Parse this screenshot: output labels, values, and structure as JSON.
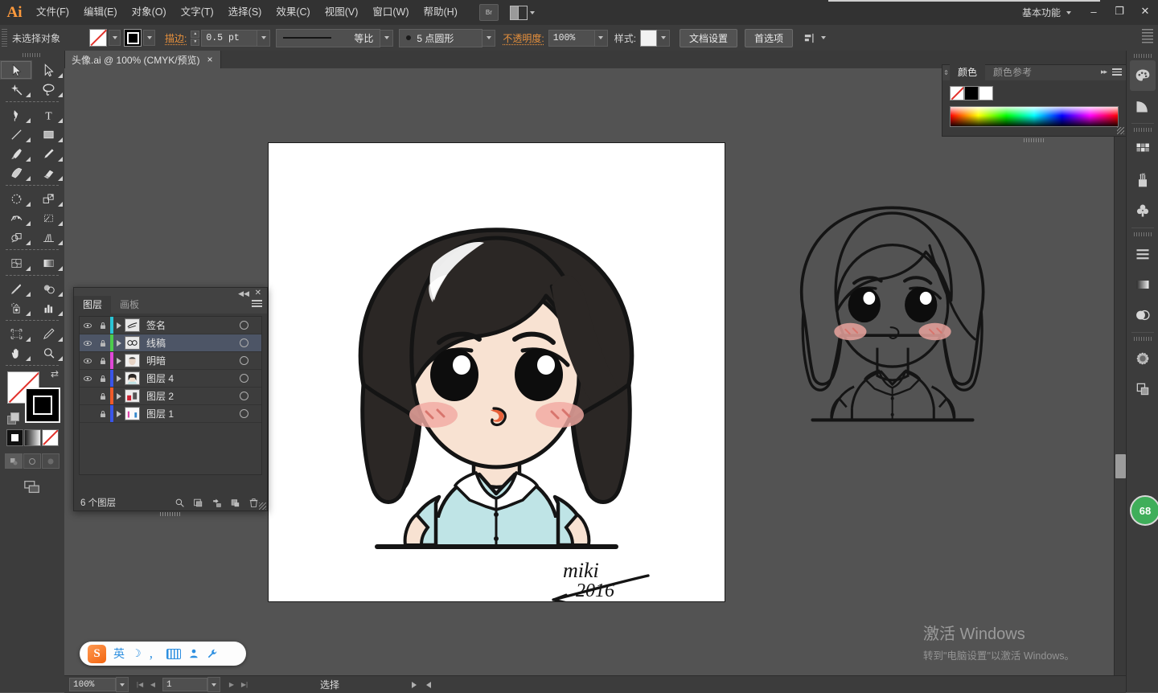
{
  "app": {
    "name": "Adobe Illustrator",
    "logo": "Ai",
    "workspace": "基本功能",
    "minimize": "–",
    "restore": "❐",
    "close": "✕",
    "bridge_label": "Br"
  },
  "menu": {
    "items": [
      {
        "label": "文件(F)",
        "name": "menu-file"
      },
      {
        "label": "编辑(E)",
        "name": "menu-edit"
      },
      {
        "label": "对象(O)",
        "name": "menu-object"
      },
      {
        "label": "文字(T)",
        "name": "menu-type"
      },
      {
        "label": "选择(S)",
        "name": "menu-select"
      },
      {
        "label": "效果(C)",
        "name": "menu-effect"
      },
      {
        "label": "视图(V)",
        "name": "menu-view"
      },
      {
        "label": "窗口(W)",
        "name": "menu-window"
      },
      {
        "label": "帮助(H)",
        "name": "menu-help"
      }
    ]
  },
  "control_bar": {
    "selection_status": "未选择对象",
    "fill_swatch": "none",
    "stroke_swatch": "black",
    "stroke_label": "描边:",
    "stroke_weight": "0.5 pt",
    "stroke_profile": "等比",
    "brush_definition": "5 点圆形",
    "opacity_label": "不透明度:",
    "opacity_value": "100%",
    "style_label": "样式:",
    "document_setup": "文档设置",
    "preferences": "首选项"
  },
  "tab": {
    "title": "头像.ai @ 100% (CMYK/预览)",
    "close": "×"
  },
  "toolbar": {
    "tools": [
      {
        "name": "selection-tool",
        "icon": "arrow-solid",
        "selected": true
      },
      {
        "name": "direct-selection-tool",
        "icon": "arrow-outline",
        "selected": false
      },
      {
        "name": "magic-wand-tool",
        "icon": "magic-wand",
        "selected": false
      },
      {
        "name": "lasso-tool",
        "icon": "lasso",
        "selected": false
      },
      {
        "name": "pen-tool",
        "icon": "pen",
        "selected": false
      },
      {
        "name": "type-tool",
        "icon": "type-T",
        "selected": false
      },
      {
        "name": "line-segment-tool",
        "icon": "line",
        "selected": false
      },
      {
        "name": "rectangle-tool",
        "icon": "rectangle",
        "selected": false
      },
      {
        "name": "paintbrush-tool",
        "icon": "paintbrush",
        "selected": false
      },
      {
        "name": "pencil-tool",
        "icon": "pencil",
        "selected": false
      },
      {
        "name": "blob-brush-tool",
        "icon": "blob-brush",
        "selected": false
      },
      {
        "name": "eraser-tool",
        "icon": "eraser",
        "selected": false
      },
      {
        "name": "rotate-tool",
        "icon": "rotate",
        "selected": false
      },
      {
        "name": "scale-tool",
        "icon": "scale",
        "selected": false
      },
      {
        "name": "width-tool",
        "icon": "width",
        "selected": false
      },
      {
        "name": "free-transform-tool",
        "icon": "free-transform",
        "selected": false
      },
      {
        "name": "shape-builder-tool",
        "icon": "shape-builder",
        "selected": false
      },
      {
        "name": "perspective-grid-tool",
        "icon": "perspective-grid",
        "selected": false
      },
      {
        "name": "mesh-tool",
        "icon": "mesh",
        "selected": false
      },
      {
        "name": "gradient-tool",
        "icon": "gradient",
        "selected": false
      },
      {
        "name": "eyedropper-tool",
        "icon": "eyedropper",
        "selected": false
      },
      {
        "name": "blend-tool",
        "icon": "blend",
        "selected": false
      },
      {
        "name": "symbol-sprayer-tool",
        "icon": "symbol-sprayer",
        "selected": false
      },
      {
        "name": "column-graph-tool",
        "icon": "bar-graph",
        "selected": false
      },
      {
        "name": "artboard-tool",
        "icon": "artboard",
        "selected": false
      },
      {
        "name": "slice-tool",
        "icon": "slice",
        "selected": false
      },
      {
        "name": "hand-tool",
        "icon": "hand",
        "selected": false
      },
      {
        "name": "zoom-tool",
        "icon": "magnifier",
        "selected": false
      }
    ],
    "fill_color": "#ffffff",
    "fill_is_none": true,
    "stroke_color": "#000000",
    "screen_modes": [
      "normal-screen",
      "full-screen-menubar",
      "full-screen"
    ],
    "draw_modes": [
      "draw-normal",
      "draw-behind",
      "draw-inside"
    ]
  },
  "layers_panel": {
    "tabs": [
      {
        "label": "图层",
        "active": true
      },
      {
        "label": "画板",
        "active": false
      }
    ],
    "rows": [
      {
        "name": "签名",
        "color": "#29c4d6",
        "visible": true,
        "locked": true,
        "selected": false
      },
      {
        "name": "线稿",
        "color": "#4ccb4c",
        "visible": true,
        "locked": true,
        "selected": true
      },
      {
        "name": "明暗",
        "color": "#e048d8",
        "visible": true,
        "locked": true,
        "selected": false
      },
      {
        "name": "图层 4",
        "color": "#3a55e8",
        "visible": true,
        "locked": true,
        "selected": false
      },
      {
        "name": "图层 2",
        "color": "#ef5a2a",
        "visible": false,
        "locked": true,
        "selected": false
      },
      {
        "name": "图层 1",
        "color": "#3a55e8",
        "visible": false,
        "locked": true,
        "selected": false
      }
    ],
    "footer_count": "6 个图层",
    "footer_icons": [
      "locate-object-icon",
      "make-clipping-mask-icon",
      "create-sublayer-icon",
      "create-new-layer-icon",
      "delete-selection-icon"
    ]
  },
  "color_panel": {
    "tabs": [
      {
        "label": "颜色",
        "active": true
      },
      {
        "label": "颜色参考",
        "active": false
      }
    ],
    "swatches": [
      "none",
      "#000000",
      "#ffffff"
    ]
  },
  "right_rail": {
    "icons": [
      {
        "name": "color-panel-icon",
        "glyph": "palette",
        "active": true
      },
      {
        "name": "color-guide-icon",
        "glyph": "quarter-circle",
        "active": false
      },
      {
        "name": "swatches-panel-icon",
        "glyph": "swatch-grid",
        "active": false
      },
      {
        "name": "brushes-panel-icon",
        "glyph": "brush-cup",
        "active": false
      },
      {
        "name": "symbols-panel-icon",
        "glyph": "clover",
        "active": false
      },
      {
        "name": "stroke-panel-icon",
        "glyph": "stroke-lines",
        "active": false
      },
      {
        "name": "gradient-panel-icon",
        "glyph": "gradient-square",
        "active": false
      },
      {
        "name": "transparency-panel-icon",
        "glyph": "overlap-circles",
        "active": false
      },
      {
        "name": "appearance-panel-icon",
        "glyph": "dotted-circle",
        "active": false
      },
      {
        "name": "graphic-styles-panel-icon",
        "glyph": "stacked-squares",
        "active": false
      }
    ],
    "badge": "68"
  },
  "status_bar": {
    "zoom": "100%",
    "page": "1",
    "tool_label": "选择"
  },
  "ime": {
    "logo": "S",
    "mode": "英",
    "items": [
      "moon-icon",
      "comma-icon",
      "keyboard-icon",
      "user-icon",
      "wrench-icon"
    ]
  },
  "watermark": {
    "title": "激活 Windows",
    "subtitle": "转到\"电脑设置\"以激活 Windows。"
  },
  "artwork": {
    "signature_name": "miki",
    "signature_year": "2016",
    "colors": {
      "hair": "#2b2725",
      "skin": "#f8e2d2",
      "blush": "#f2a9a2",
      "shirt": "#bfe4e6",
      "lips": "#e8613a",
      "outline": "#141414",
      "canvas_bg": "#535353",
      "artboard_bg": "#ffffff"
    }
  }
}
